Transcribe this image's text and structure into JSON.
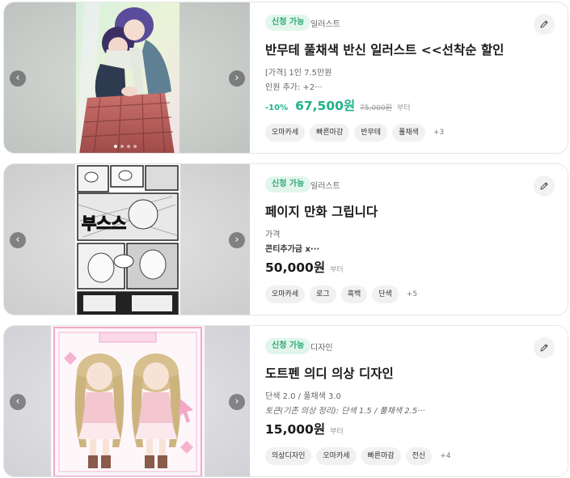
{
  "cards": [
    {
      "badge": "신청 가능",
      "category": "일러스트",
      "title": "반무테 풀채색 반신 일러스트 <<선착순 할인",
      "line1": "[가격] 1인 7.5만원",
      "line2": "인원 추가: +2···",
      "discount": "-10%",
      "price": "67,500원",
      "original_price": "75,000원",
      "price_suffix": "부터",
      "tags": [
        "오마카세",
        "빠른마감",
        "반무테",
        "풀채색"
      ],
      "more_tags": "+3",
      "image_icon": "illustration-couple-scarf"
    },
    {
      "badge": "신청 가능",
      "category": "일러스트",
      "title": "페이지 만화 그립니다",
      "line1": "가격",
      "line2": "콘티추가금 x···",
      "price": "50,000원",
      "price_suffix": "부터",
      "tags": [
        "오마카세",
        "로그",
        "흑백",
        "단색"
      ],
      "more_tags": "+5",
      "image_icon": "manga-page"
    },
    {
      "badge": "신청 가능",
      "category": "디자인",
      "title": "도트펜 의디 의상 디자인",
      "line1": "단색 2.0 / 풀채색 3.0",
      "line2": "토큰(기존 의상 정리): 단색 1.5 / 풀채색 2.5···",
      "price": "15,000원",
      "price_suffix": "부터",
      "tags": [
        "의상디자인",
        "오마카세",
        "빠른마감",
        "전신"
      ],
      "more_tags": "+4",
      "image_icon": "character-design-sheet"
    }
  ],
  "colors": {
    "badge_bg": "#e2f6ec",
    "badge_text": "#2fa874",
    "discount_green": "#1fb389",
    "tag_bg": "#f1f1f1"
  },
  "icons": {
    "prev": "chevron-left-icon",
    "next": "chevron-right-icon",
    "edit": "pencil-icon"
  }
}
